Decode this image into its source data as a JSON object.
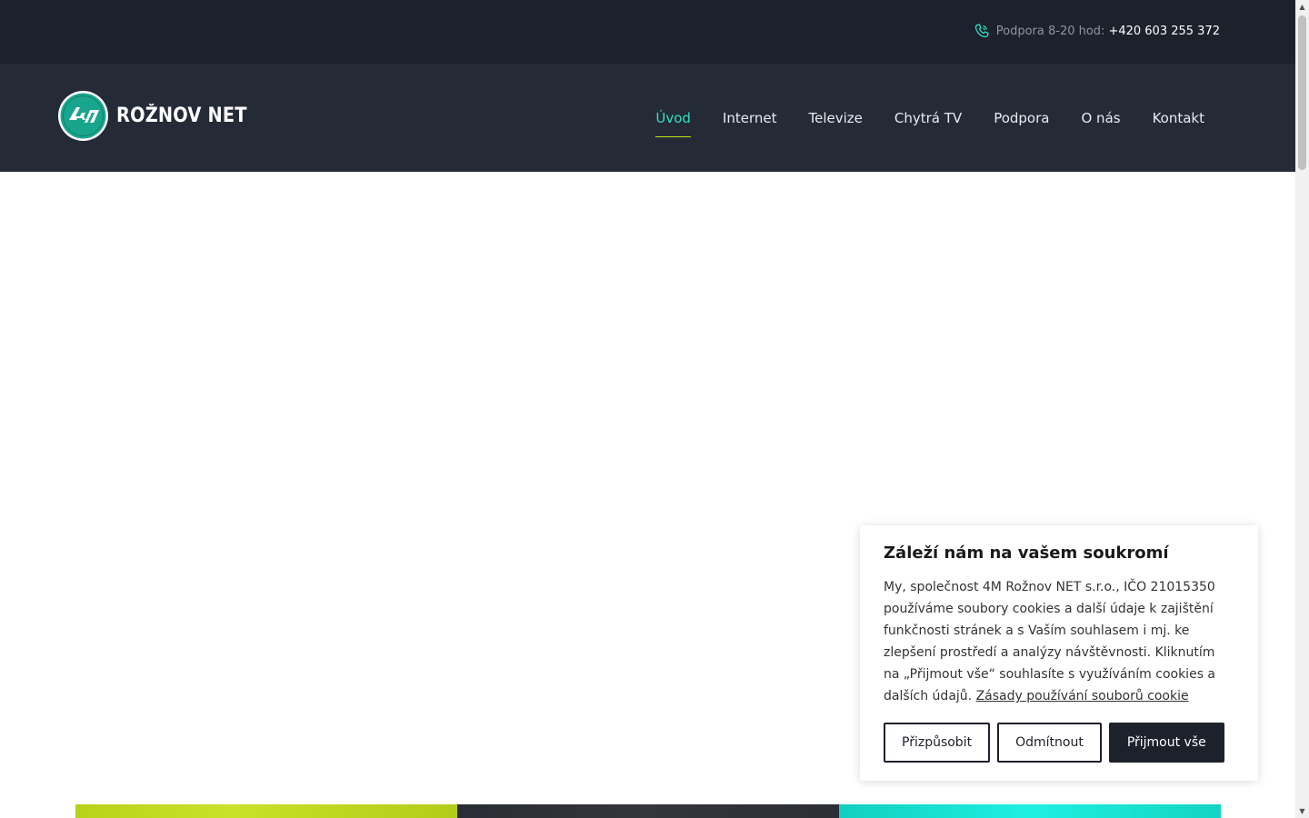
{
  "topbar": {
    "support_label": "Podpora 8-20 hod:",
    "phone": "+420 603 255 372",
    "icon": "phone-icon"
  },
  "header": {
    "brand": "ROŽNOV NET",
    "logo_mark": "4M",
    "nav": [
      {
        "label": "Úvod",
        "active": true
      },
      {
        "label": "Internet"
      },
      {
        "label": "Televize"
      },
      {
        "label": "Chytrá TV"
      },
      {
        "label": "Podpora"
      },
      {
        "label": "O nás"
      },
      {
        "label": "Kontakt"
      }
    ]
  },
  "cookie": {
    "title": "Záleží nám na vašem soukromí",
    "body": "My, společnost 4M Rožnov NET s.r.o., IČO 21015350 používáme soubory cookies a další údaje k zajištění funkčnosti stránek a s Vaším souhlasem i mj. ke zlepšení prostředí a analýzy návštěvnosti. Kliknutím na „Přijmout vše“ souhlasíte s využíváním cookies a dalších údajů.",
    "link": "Zásady používání souborů cookie",
    "buttons": {
      "customize": "Přizpůsobit",
      "reject": "Odmítnout",
      "accept": "Přijmout vše"
    }
  },
  "colors": {
    "topbar_bg": "#1d212b",
    "header_bg": "#252a37",
    "accent_teal": "#2fe0c0",
    "accent_lime": "#c4e31c"
  }
}
